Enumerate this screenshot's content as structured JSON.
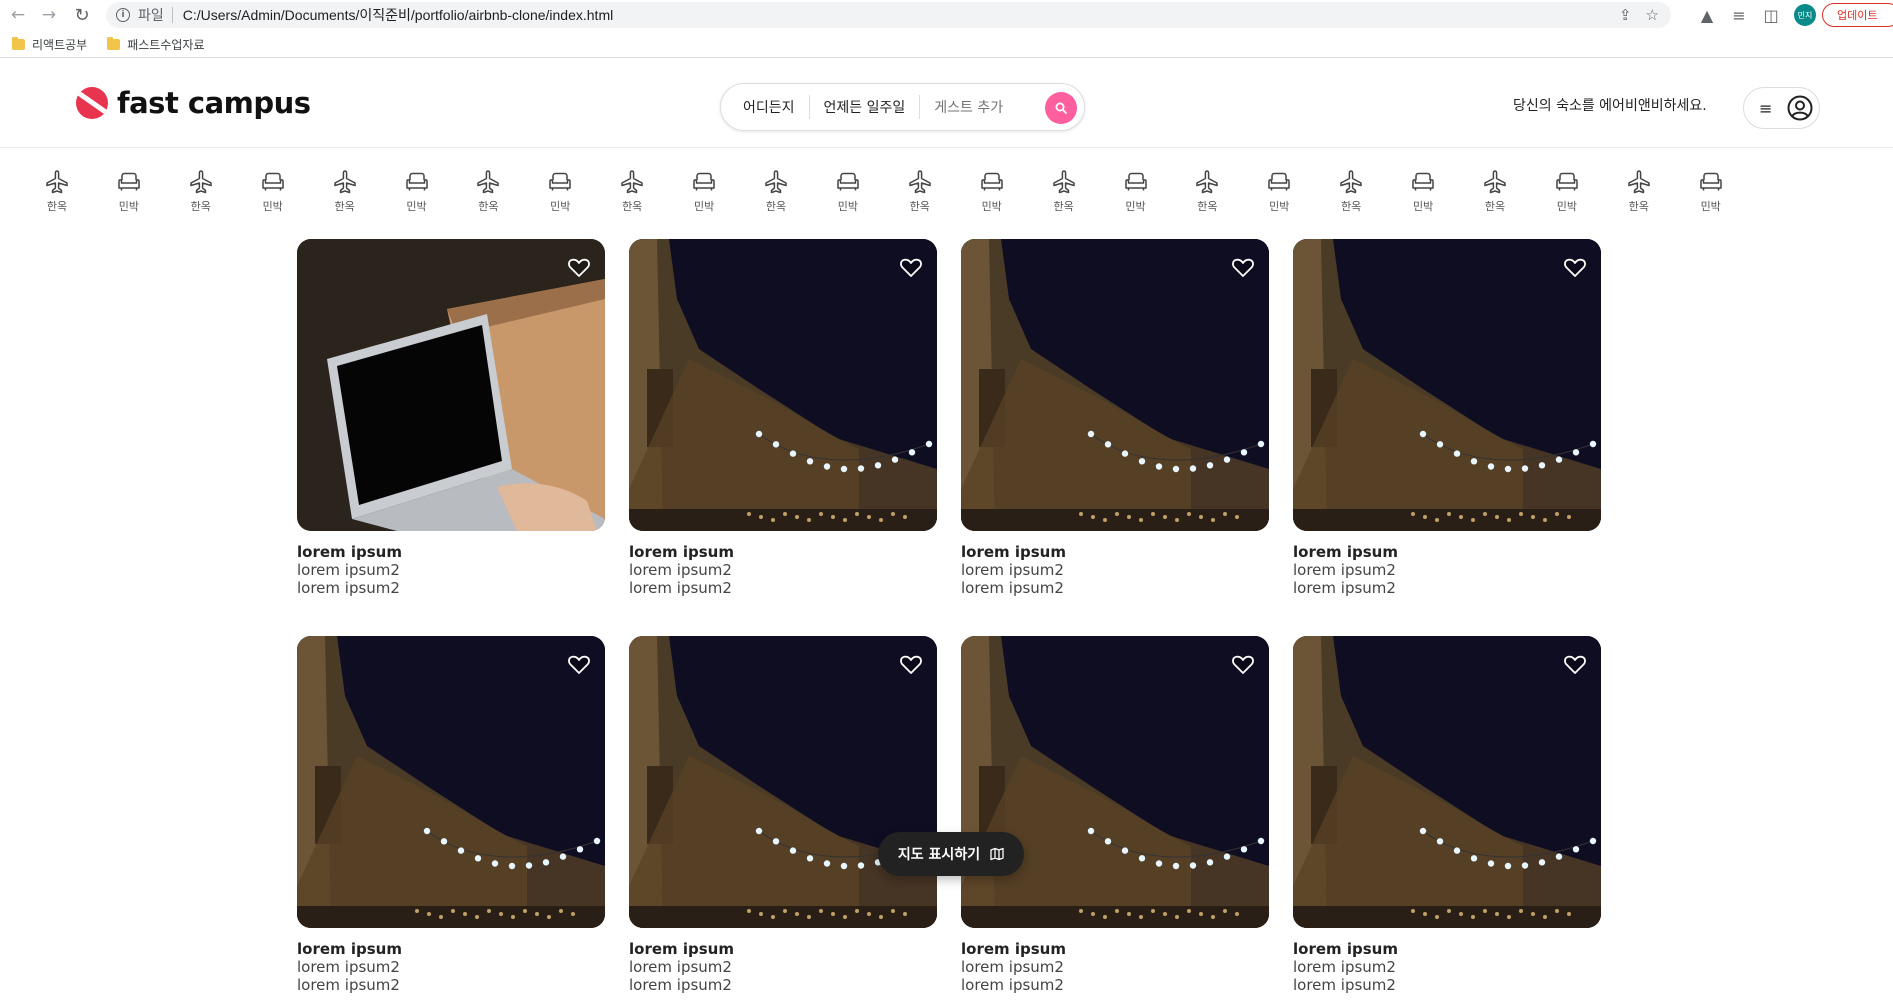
{
  "browser": {
    "scheme_label": "파일",
    "url": "C:/Users/Admin/Documents/이직준비/portfolio/airbnb-clone/index.html",
    "profile_label": "민지",
    "update_label": "업데이트",
    "bookmarks": [
      {
        "label": "리액트공부"
      },
      {
        "label": "패스트수업자료"
      }
    ]
  },
  "header": {
    "logo_text": "fast campus",
    "search": {
      "where": "어디든지",
      "when": "언제든 일주일",
      "guests": "게스트 추가"
    },
    "host_link": "당신의 숙소를 에어비앤비하세요."
  },
  "categories": [
    {
      "label": "한옥",
      "icon": "airplane-icon"
    },
    {
      "label": "민박",
      "icon": "sofa-icon"
    },
    {
      "label": "한옥",
      "icon": "airplane-icon"
    },
    {
      "label": "민박",
      "icon": "sofa-icon"
    },
    {
      "label": "한옥",
      "icon": "airplane-icon"
    },
    {
      "label": "민박",
      "icon": "sofa-icon"
    },
    {
      "label": "한옥",
      "icon": "airplane-icon"
    },
    {
      "label": "민박",
      "icon": "sofa-icon"
    },
    {
      "label": "한옥",
      "icon": "airplane-icon"
    },
    {
      "label": "민박",
      "icon": "sofa-icon"
    },
    {
      "label": "한옥",
      "icon": "airplane-icon"
    },
    {
      "label": "민박",
      "icon": "sofa-icon"
    },
    {
      "label": "한옥",
      "icon": "airplane-icon"
    },
    {
      "label": "민박",
      "icon": "sofa-icon"
    },
    {
      "label": "한옥",
      "icon": "airplane-icon"
    },
    {
      "label": "민박",
      "icon": "sofa-icon"
    },
    {
      "label": "한옥",
      "icon": "airplane-icon"
    },
    {
      "label": "민박",
      "icon": "sofa-icon"
    },
    {
      "label": "한옥",
      "icon": "airplane-icon"
    },
    {
      "label": "민박",
      "icon": "sofa-icon"
    },
    {
      "label": "한옥",
      "icon": "airplane-icon"
    },
    {
      "label": "민박",
      "icon": "sofa-icon"
    },
    {
      "label": "한옥",
      "icon": "airplane-icon"
    },
    {
      "label": "민박",
      "icon": "sofa-icon"
    }
  ],
  "listings": [
    {
      "title": "lorem ipsum",
      "line1": "lorem ipsum2",
      "line2": "lorem ipsum2",
      "image": "laptop"
    },
    {
      "title": "lorem ipsum",
      "line1": "lorem ipsum2",
      "line2": "lorem ipsum2",
      "image": "night-street"
    },
    {
      "title": "lorem ipsum",
      "line1": "lorem ipsum2",
      "line2": "lorem ipsum2",
      "image": "night-street"
    },
    {
      "title": "lorem ipsum",
      "line1": "lorem ipsum2",
      "line2": "lorem ipsum2",
      "image": "night-street"
    },
    {
      "title": "lorem ipsum",
      "line1": "lorem ipsum2",
      "line2": "lorem ipsum2",
      "image": "night-street"
    },
    {
      "title": "lorem ipsum",
      "line1": "lorem ipsum2",
      "line2": "lorem ipsum2",
      "image": "night-street"
    },
    {
      "title": "lorem ipsum",
      "line1": "lorem ipsum2",
      "line2": "lorem ipsum2",
      "image": "night-street"
    },
    {
      "title": "lorem ipsum",
      "line1": "lorem ipsum2",
      "line2": "lorem ipsum2",
      "image": "night-street"
    }
  ],
  "map_button": {
    "label": "지도 표시하기",
    "icon": "map-icon"
  },
  "colors": {
    "brand": "#e8344e",
    "search_button": "#ff5f9e",
    "map_button": "#222222"
  }
}
